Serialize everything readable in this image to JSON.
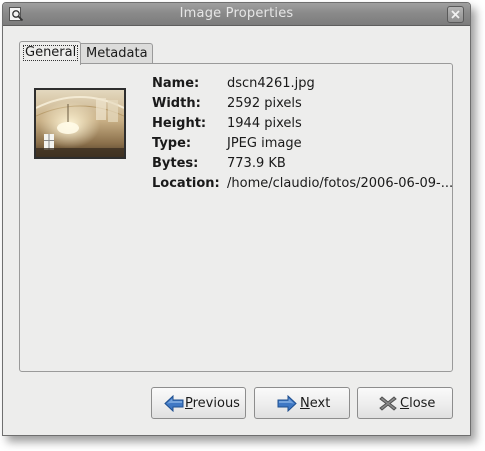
{
  "window": {
    "title": "Image Properties"
  },
  "tabs": [
    {
      "label": "General",
      "selected": true
    },
    {
      "label": "Metadata",
      "selected": false
    }
  ],
  "general": {
    "properties": [
      {
        "label": "Name:",
        "value": "dscn4261.jpg"
      },
      {
        "label": "Width:",
        "value": "2592 pixels"
      },
      {
        "label": "Height:",
        "value": "1944 pixels"
      },
      {
        "label": "Type:",
        "value": "JPEG image"
      },
      {
        "label": "Bytes:",
        "value": "773.9 KB"
      },
      {
        "label": "Location:",
        "value": "/home/claudio/fotos/2006-06-09-..."
      }
    ]
  },
  "buttons": {
    "previous": {
      "mnemonic": "P",
      "rest": "revious",
      "icon": "arrow-left-icon"
    },
    "next": {
      "mnemonic": "N",
      "rest": "ext",
      "icon": "arrow-right-icon"
    },
    "close": {
      "mnemonic": "C",
      "rest": "lose",
      "icon": "close-x-icon"
    }
  },
  "colors": {
    "titlebar": "#8a8a8a",
    "window_bg": "#ededec",
    "arrow_blue": "#3f78c4"
  }
}
